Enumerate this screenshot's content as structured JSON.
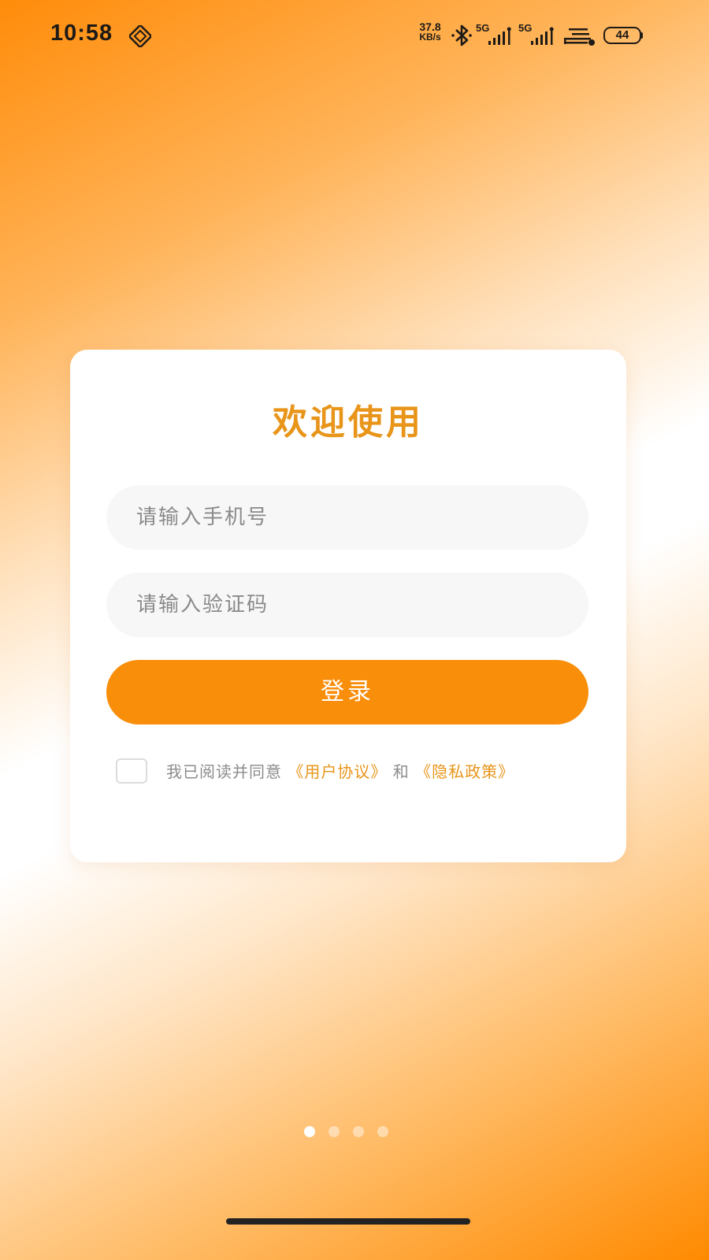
{
  "status_bar": {
    "time": "10:58",
    "net_speed_value": "37.8",
    "net_speed_unit": "KB/s",
    "signal_1_label": "5G",
    "signal_2_label": "5G",
    "battery_level": "44",
    "icons": [
      "nfc-icon",
      "bluetooth-icon",
      "signal-icon",
      "signal-icon",
      "wifi-icon",
      "battery-icon"
    ]
  },
  "login_card": {
    "title": "欢迎使用",
    "phone_placeholder": "请输入手机号",
    "code_placeholder": "请输入验证码",
    "login_label": "登录",
    "agreement": {
      "prefix": "我已阅读并同意",
      "user_agreement": "《用户协议》",
      "joiner": "和",
      "privacy_policy": "《隐私政策》",
      "checked": false
    }
  },
  "pager": {
    "page_count": 4,
    "active_index": 0
  },
  "colors": {
    "accent": "#f98e0b",
    "title": "#e8951a",
    "link": "#e8951a",
    "input_bg": "#f7f7f7"
  }
}
